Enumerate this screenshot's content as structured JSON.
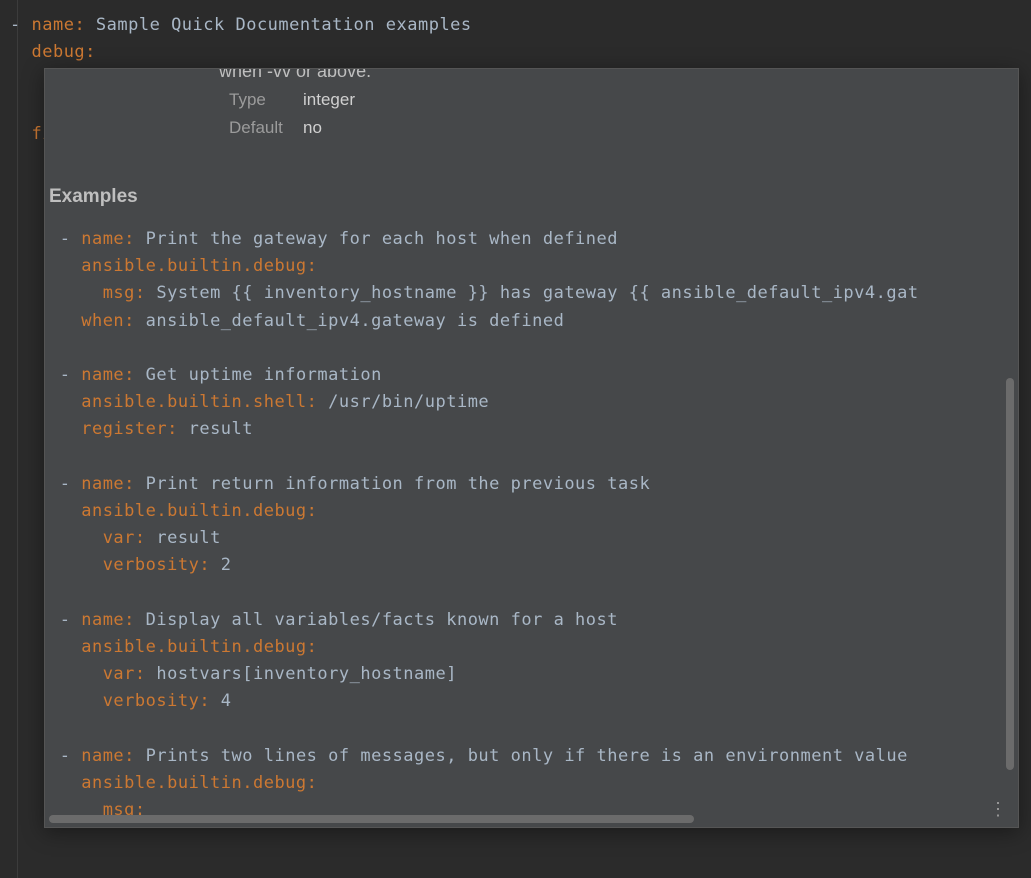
{
  "editor": {
    "line1_key": "name",
    "line1_value": "Sample Quick Documentation examples",
    "line2_key": "debug",
    "line3_key": "fi"
  },
  "popup": {
    "partial_text": "when -vv or above.",
    "params": [
      {
        "label": "Type",
        "value": "integer"
      },
      {
        "label": "Default",
        "value": "no"
      }
    ],
    "examples_header": "Examples",
    "examples": [
      {
        "name_key": "name",
        "name_value": "Print the gateway for each host when defined",
        "module": "ansible.builtin.debug",
        "args": [
          {
            "key": "msg",
            "value": "System {{ inventory_hostname }} has gateway {{ ansible_default_ipv4.gat",
            "indent": 2
          }
        ],
        "extra": [
          {
            "key": "when",
            "value": "ansible_default_ipv4.gateway is defined",
            "indent": 1
          }
        ]
      },
      {
        "name_key": "name",
        "name_value": "Get uptime information",
        "module": "ansible.builtin.shell",
        "module_value": "/usr/bin/uptime",
        "extra": [
          {
            "key": "register",
            "value": "result",
            "indent": 1
          }
        ]
      },
      {
        "name_key": "name",
        "name_value": "Print return information from the previous task",
        "module": "ansible.builtin.debug",
        "args": [
          {
            "key": "var",
            "value": "result",
            "indent": 2
          },
          {
            "key": "verbosity",
            "value": "2",
            "indent": 2
          }
        ]
      },
      {
        "name_key": "name",
        "name_value": "Display all variables/facts known for a host",
        "module": "ansible.builtin.debug",
        "args": [
          {
            "key": "var",
            "value": "hostvars[inventory_hostname]",
            "indent": 2
          },
          {
            "key": "verbosity",
            "value": "4",
            "indent": 2
          }
        ]
      },
      {
        "name_key": "name",
        "name_value": "Prints two lines of messages, but only if there is an environment value ",
        "module": "ansible.builtin.debug",
        "args": [
          {
            "key": "msg",
            "value": "",
            "indent": 2
          }
        ]
      }
    ]
  }
}
